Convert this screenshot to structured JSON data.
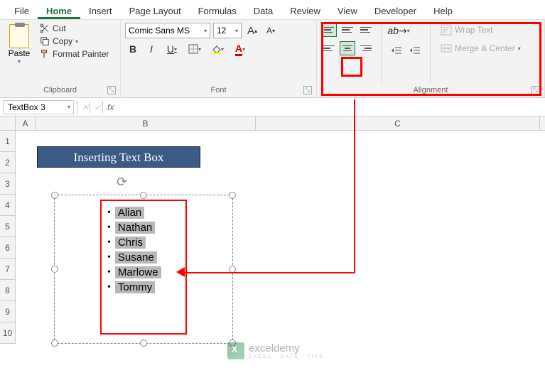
{
  "tabs": {
    "file": "File",
    "home": "Home",
    "insert": "Insert",
    "page_layout": "Page Layout",
    "formulas": "Formulas",
    "data": "Data",
    "review": "Review",
    "view": "View",
    "developer": "Developer",
    "help": "Help"
  },
  "clipboard": {
    "paste": "Paste",
    "cut": "Cut",
    "copy": "Copy",
    "format_painter": "Format Painter",
    "label": "Clipboard"
  },
  "font": {
    "name": "Comic Sans MS",
    "size": "12",
    "label": "Font",
    "bold": "B",
    "italic": "I",
    "underline": "U",
    "increase": "A",
    "decrease": "A"
  },
  "alignment": {
    "label": "Alignment",
    "wrap_text": "Wrap Text",
    "merge_center": "Merge & Center"
  },
  "namebox": "TextBox 3",
  "fx": "fx",
  "cancel": "✕",
  "check": "✓",
  "cols": {
    "a": "A",
    "b": "B",
    "c": "C"
  },
  "rows": [
    "1",
    "2",
    "3",
    "4",
    "5",
    "6",
    "7",
    "8",
    "9",
    "10"
  ],
  "title_banner": "Inserting Text Box",
  "bullets": [
    "Alian",
    "Nathan",
    "Chris",
    "Susane",
    "Marlowe",
    "Tommy"
  ],
  "watermark": {
    "brand": "exceldemy",
    "tag": "EXCEL · DATA · TIPS"
  }
}
